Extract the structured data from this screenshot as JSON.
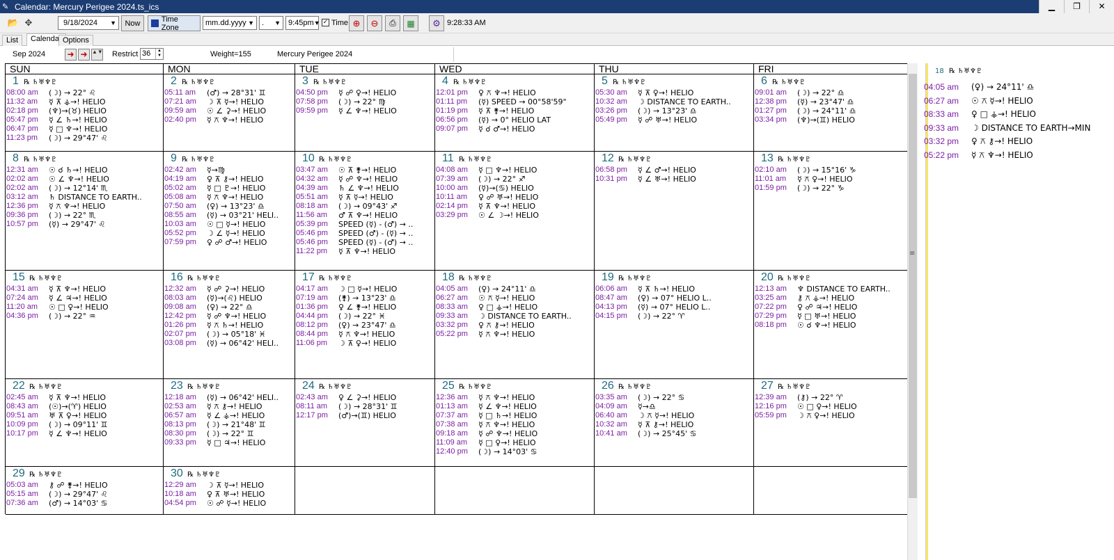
{
  "window": {
    "title": "Calendar: Mercury Perigee 2024.ts_ics",
    "min_label": "▁",
    "max_label": "❐",
    "close_label": "✕"
  },
  "toolbar": {
    "date_value": "9/18/2024",
    "now_label": "Now",
    "timezone_label": "Time Zone",
    "date_format": "mm.dd.yyyy",
    "sep_value": ".",
    "time_value": "9:45pm",
    "time_checkbox_label": "Time",
    "clock": "9:28:33 AM"
  },
  "tabs": [
    "List",
    "Calendar",
    "Options"
  ],
  "nav": {
    "month_label": "Sep  2024",
    "restrict_label": "Restrict",
    "restrict_value": "36",
    "weight_label": "Weight=155",
    "file_label": "Mercury Perigee 2024"
  },
  "day_headers": [
    "SUN",
    "MON",
    "TUE",
    "WED",
    "THU",
    "FRI"
  ],
  "day_symbol": "℞ ♄♅♆♇",
  "weeks": [
    [
      {
        "day": "1",
        "events": [
          [
            "08:00 am",
            "(☽) → 22° ♌"
          ],
          [
            "11:32 am",
            "☿ ⊼ ⚶→! HELIO"
          ],
          [
            "02:18 pm",
            "(♆)→(♉) HELIO"
          ],
          [
            "05:47 pm",
            "☿ ∠ ♄→! HELIO"
          ],
          [
            "06:47 pm",
            "☿ □ ♆→! HELIO"
          ],
          [
            "11:23 pm",
            "(☽) → 29°47' ♌"
          ]
        ]
      },
      {
        "day": "2",
        "events": [
          [
            "05:11 am",
            "(♂) → 28°31' ♊"
          ],
          [
            "07:21 am",
            "☽ ⊼ ☿→! HELIO"
          ],
          [
            "09:59 am",
            "☉ ∠ ⚳→! HELIO"
          ],
          [
            "02:40 pm",
            "☿ ⚻ ♆→! HELIO"
          ]
        ]
      },
      {
        "day": "3",
        "events": [
          [
            "04:50 pm",
            "☿ ☍ ♀→! HELIO"
          ],
          [
            "07:58 pm",
            "(☽) → 22° ♍"
          ],
          [
            "09:59 pm",
            "☿ ∠ ♆→! HELIO"
          ]
        ]
      },
      {
        "day": "4",
        "events": [
          [
            "12:01 pm",
            "♀ ⚻ ♆→! HELIO"
          ],
          [
            "01:11 pm",
            "(☿) SPEED → 00°58'59\""
          ],
          [
            "01:19 pm",
            "☿ ⊼ ⚵→! HELIO"
          ],
          [
            "06:56 pm",
            "(☿) → 0°  HELIO LAT"
          ],
          [
            "09:07 pm",
            "☿ ☌ ♂→! HELIO"
          ]
        ]
      },
      {
        "day": "5",
        "events": [
          [
            "05:30 am",
            "☿ ⊼ ♀→! HELIO"
          ],
          [
            "10:32 am",
            "☽ DISTANCE TO EARTH.."
          ],
          [
            "03:26 pm",
            "(☽) → 13°23' ♎"
          ],
          [
            "05:49 pm",
            "☿ ☍ ♅→! HELIO"
          ]
        ]
      },
      {
        "day": "6",
        "events": [
          [
            "09:01 am",
            "(☽) → 22° ♎"
          ],
          [
            "12:38 pm",
            "(☿) → 23°47' ♎"
          ],
          [
            "01:27 pm",
            "(☽) → 24°11' ♎"
          ],
          [
            "03:34 pm",
            "(♆)→(♊) HELIO"
          ]
        ]
      }
    ],
    [
      {
        "day": "8",
        "events": [
          [
            "12:31 am",
            "☉ ☌ ♄→! HELIO"
          ],
          [
            "02:02 am",
            "☉ ∠ ♆→! HELIO"
          ],
          [
            "02:02 am",
            "(☽) → 12°14' ♏"
          ],
          [
            "03:12 am",
            "♄ DISTANCE TO EARTH.."
          ],
          [
            "12:36 pm",
            "☿ ⚻ ♆→! HELIO"
          ],
          [
            "09:36 pm",
            "(☽) → 22° ♏"
          ],
          [
            "10:57 pm",
            "(☿) → 29°47' ♌"
          ]
        ]
      },
      {
        "day": "9",
        "events": [
          [
            "02:42 am",
            "☿→♍"
          ],
          [
            "04:19 am",
            "♀ ⊼ ⚷→! HELIO"
          ],
          [
            "05:02 am",
            "☿ □ ♇→! HELIO"
          ],
          [
            "05:08 am",
            "☿ ⚻ ♆→! HELIO"
          ],
          [
            "07:50 am",
            "(♀) → 13°23' ♎"
          ],
          [
            "08:55 am",
            "(☿) → 03°21'  HELI.."
          ],
          [
            "10:03 am",
            "☉ □ ☿→! HELIO"
          ],
          [
            "05:52 pm",
            "☽ ∠ ☿→! HELIO"
          ],
          [
            "07:59 pm",
            "♀ ☍ ♂→! HELIO"
          ]
        ]
      },
      {
        "day": "10",
        "events": [
          [
            "03:47 am",
            "☉ ⊼ ⚵→! HELIO"
          ],
          [
            "04:32 am",
            "☿ ☍ ♆→! HELIO"
          ],
          [
            "04:39 am",
            "♄ ∠ ♆→! HELIO"
          ],
          [
            "05:51 am",
            "☿ ⊼ ☿→! HELIO"
          ],
          [
            "08:18 am",
            "(☽) → 09°43' ♐"
          ],
          [
            "11:56 am",
            "♂ ⊼ ♆→! HELIO"
          ],
          [
            "05:39 pm",
            "SPEED (☿) - (♂) → .."
          ],
          [
            "05:46 pm",
            "SPEED (♂) - (☿) → .."
          ],
          [
            "05:46 pm",
            "SPEED (☿) - (♂) → .."
          ],
          [
            "11:22 pm",
            "☿ ⊼ ♆→! HELIO"
          ]
        ]
      },
      {
        "day": "11",
        "events": [
          [
            "04:08 am",
            "☿ □ ♆→! HELIO"
          ],
          [
            "07:39 am",
            "(☽) → 22° ♐"
          ],
          [
            "10:00 am",
            "(☿)→(♋) HELIO"
          ],
          [
            "10:11 am",
            "♀ ☍ ♅→! HELIO"
          ],
          [
            "02:14 pm",
            "☿ ⊼ ♆→! HELIO"
          ],
          [
            "03:29 pm",
            "☉ ∠ ☽→! HELIO"
          ]
        ]
      },
      {
        "day": "12",
        "events": [
          [
            "06:58 pm",
            "☿ ∠ ♂→! HELIO"
          ],
          [
            "10:31 pm",
            "☿ ∠ ♅→! HELIO"
          ]
        ]
      },
      {
        "day": "13",
        "events": [
          [
            "02:10 am",
            "(☽) → 15°16' ♑"
          ],
          [
            "11:01 am",
            "☿ ⚻ ♀→! HELIO"
          ],
          [
            "01:59 pm",
            "(☽) → 22° ♑"
          ]
        ]
      }
    ],
    [
      {
        "day": "15",
        "events": [
          [
            "04:31 am",
            "☿ ⊼ ♆→! HELIO"
          ],
          [
            "07:24 am",
            "☿ ∠ ♃→! HELIO"
          ],
          [
            "11:20 am",
            "☉ □ ♀→! HELIO"
          ],
          [
            "04:36 pm",
            "(☽) → 22° ♒"
          ]
        ]
      },
      {
        "day": "16",
        "events": [
          [
            "12:32 am",
            "☿ ☍ ⚳→! HELIO"
          ],
          [
            "08:03 am",
            "(☿)→(♌) HELIO"
          ],
          [
            "09:08 am",
            "(♀) → 22° ♎"
          ],
          [
            "12:42 pm",
            "☿ ☍ ♆→! HELIO"
          ],
          [
            "01:26 pm",
            "☿ ⚻ ♄→! HELIO"
          ],
          [
            "02:07 pm",
            "(☽) → 05°18' ♓"
          ],
          [
            "03:08 pm",
            "(☿) → 06°42'  HELI.."
          ]
        ]
      },
      {
        "day": "17",
        "events": [
          [
            "04:17 am",
            "☽ □ ☿→! HELIO"
          ],
          [
            "07:19 am",
            "(⚵) → 13°23' ♎"
          ],
          [
            "01:36 pm",
            "♀ ∠ ⚵→! HELIO"
          ],
          [
            "04:44 pm",
            "(☽) → 22° ♓"
          ],
          [
            "08:12 pm",
            "(♀) → 23°47' ♎"
          ],
          [
            "08:44 pm",
            "☿ ⚻ ♆→! HELIO"
          ],
          [
            "11:06 pm",
            "☽ ⊼ ♀→! HELIO"
          ]
        ]
      },
      {
        "day": "18",
        "events": [
          [
            "04:05 am",
            "(♀) → 24°11' ♎"
          ],
          [
            "06:27 am",
            "☉ ⚻ ☿→! HELIO"
          ],
          [
            "08:33 am",
            "♀ □ ⚶→! HELIO"
          ],
          [
            "09:33 am",
            "☽ DISTANCE TO EARTH.."
          ],
          [
            "03:32 pm",
            "♀ ⚻ ⚷→! HELIO"
          ],
          [
            "05:22 pm",
            "☿ ⚻ ♆→! HELIO"
          ]
        ]
      },
      {
        "day": "19",
        "events": [
          [
            "06:06 am",
            "☿ ⊼ ♄→! HELIO"
          ],
          [
            "08:47 am",
            "(♀) → 07°  HELIO L.."
          ],
          [
            "04:13 pm",
            "(☿) → 07°  HELIO L.."
          ],
          [
            "04:15 pm",
            "(☽) → 22° ♈"
          ]
        ]
      },
      {
        "day": "20",
        "events": [
          [
            "12:13 am",
            "♆ DISTANCE TO EARTH.."
          ],
          [
            "03:25 am",
            "⚷ ⚻ ⚶→! HELIO"
          ],
          [
            "07:22 pm",
            "♀ ☍ ♃→! HELIO"
          ],
          [
            "07:29 pm",
            "☿ □ ♅→! HELIO"
          ],
          [
            "08:18 pm",
            "☉ ☌ ♆→! HELIO"
          ]
        ]
      }
    ],
    [
      {
        "day": "22",
        "events": [
          [
            "02:45 am",
            "☿ ⊼ ♆→! HELIO"
          ],
          [
            "08:43 am",
            "(☉)→(♈) HELIO"
          ],
          [
            "09:51 am",
            "♅ ⊼ ♀→! HELIO"
          ],
          [
            "10:09 pm",
            "(☽) → 09°11' ♊"
          ],
          [
            "10:17 pm",
            "☿ ∠ ♆→! HELIO"
          ]
        ]
      },
      {
        "day": "23",
        "events": [
          [
            "12:18 am",
            "(☿) → 06°42'  HELI.."
          ],
          [
            "02:53 am",
            "☿ ⚻ ⚷→! HELIO"
          ],
          [
            "06:57 am",
            "☿ ∠ ⚶→! HELIO"
          ],
          [
            "08:13 pm",
            "(☽) → 21°48' ♊"
          ],
          [
            "08:30 pm",
            "(☽) → 22° ♊"
          ],
          [
            "09:33 pm",
            "☿ □ ♃→! HELIO"
          ]
        ]
      },
      {
        "day": "24",
        "events": [
          [
            "02:43 am",
            "♀ ∠ ⚳→! HELIO"
          ],
          [
            "08:11 am",
            "(☽) → 28°31' ♊"
          ],
          [
            "12:17 pm",
            "(♂)→(♊) HELIO"
          ]
        ]
      },
      {
        "day": "25",
        "events": [
          [
            "12:36 am",
            "☿ ⚻ ♆→! HELIO"
          ],
          [
            "01:13 am",
            "☿ ∠ ♆→! HELIO"
          ],
          [
            "07:37 am",
            "☿ □ ♄→! HELIO"
          ],
          [
            "07:38 am",
            "☿ ⚻ ♆→! HELIO"
          ],
          [
            "09:18 am",
            "☿ ☍ ♆→! HELIO"
          ],
          [
            "11:09 am",
            "☿ □ ♀→! HELIO"
          ],
          [
            "12:40 pm",
            "(☽) → 14°03' ♋"
          ]
        ]
      },
      {
        "day": "26",
        "events": [
          [
            "03:35 am",
            "(☽) → 22° ♋"
          ],
          [
            "04:09 am",
            "☿→♎"
          ],
          [
            "06:40 am",
            "☽ ⚻ ☿→! HELIO"
          ],
          [
            "10:32 am",
            "☿ ⊼ ⚷→! HELIO"
          ],
          [
            "10:41 am",
            "(☽) → 25°45' ♋"
          ]
        ]
      },
      {
        "day": "27",
        "events": [
          [
            "12:39 am",
            "(⚷) → 22° ♈"
          ],
          [
            "12:16 pm",
            "☉ □ ♀→! HELIO"
          ],
          [
            "05:59 pm",
            "☽ ⚻ ♀→! HELIO"
          ]
        ]
      }
    ],
    [
      {
        "day": "29",
        "events": [
          [
            "05:03 am",
            "⚷ ☍ ⚵→! HELIO"
          ],
          [
            "05:15 am",
            "(☽) → 29°47' ♌"
          ],
          [
            "07:36 am",
            "(♂) → 14°03' ♋"
          ]
        ]
      },
      {
        "day": "30",
        "events": [
          [
            "12:29 am",
            "☽ ⊼ ☿→! HELIO"
          ],
          [
            "10:18 am",
            "♀ ⊼ ♅→! HELIO"
          ],
          [
            "04:54 pm",
            "☉ ☍ ☿→! HELIO"
          ]
        ]
      },
      null,
      null,
      null,
      null
    ]
  ],
  "side_panel": {
    "day": "18",
    "events": [
      [
        "04:05 am",
        "(♀) → 24°11' ♎"
      ],
      [
        "06:27 am",
        "☉ ⚻ ☿→! HELIO"
      ],
      [
        "08:33 am",
        "♀ □ ⚶→! HELIO"
      ],
      [
        "09:33 am",
        "☽ DISTANCE TO EARTH→MIN"
      ],
      [
        "03:32 pm",
        "♀ ⚻ ⚷→! HELIO"
      ],
      [
        "05:22 pm",
        "☿ ⚻ ♆→! HELIO"
      ]
    ]
  }
}
